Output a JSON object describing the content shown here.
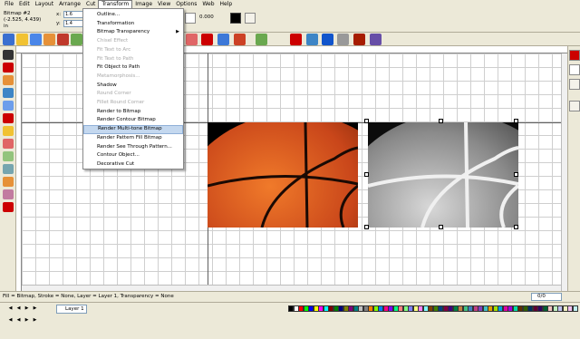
{
  "menubar": {
    "items": [
      "File",
      "Edit",
      "Layout",
      "Arrange",
      "Cut",
      "Transform",
      "Image",
      "View",
      "Options",
      "Web",
      "Help"
    ],
    "active": "Transform"
  },
  "propbar": {
    "object_name": "Bitmap #2",
    "coords": "(-2.525, 4.439)",
    "unit": "in",
    "x_label": "x:",
    "y_label": "y:",
    "x_value": "1.6",
    "y_value": "1.4",
    "angle_value": "0.000"
  },
  "transform_menu": {
    "items": [
      {
        "label": "Outline...",
        "disabled": false
      },
      {
        "label": "Transformation",
        "disabled": false
      },
      {
        "label": "Bitmap Transparency",
        "disabled": false,
        "submenu": true
      },
      {
        "label": "Chisel Effect",
        "disabled": true
      },
      {
        "label": "Fit Text to Arc",
        "disabled": true
      },
      {
        "label": "Fit Text to Path",
        "disabled": true
      },
      {
        "label": "Fit Object to Path",
        "disabled": false
      },
      {
        "label": "Metamorphosis...",
        "disabled": true
      },
      {
        "label": "Shadow",
        "disabled": false
      },
      {
        "label": "Round Corner",
        "disabled": true
      },
      {
        "label": "Fillet Round Corner",
        "disabled": true
      },
      {
        "label": "Render to Bitmap",
        "disabled": false
      },
      {
        "label": "Render Contour Bitmap",
        "disabled": false
      },
      {
        "label": "Render Multi-tone Bitmap",
        "disabled": false,
        "highlight": true
      },
      {
        "label": "Render Pattern Fill Bitmap",
        "disabled": false
      },
      {
        "label": "Render See Through Pattern...",
        "disabled": false
      },
      {
        "label": "Contour Object...",
        "disabled": false
      },
      {
        "label": "Decorative Cut",
        "disabled": false
      }
    ]
  },
  "status": {
    "text": "Fill = Bitmap, Stroke = None, Layer = Layer 1, Transparency = None",
    "page": "0/0"
  },
  "layers": {
    "active_layer": "Layer 1"
  },
  "palette": {
    "colors": [
      "#000000",
      "#ffffff",
      "#ff0000",
      "#00ff00",
      "#0000ff",
      "#ffff00",
      "#ff00ff",
      "#00ffff",
      "#800000",
      "#008000",
      "#000080",
      "#808000",
      "#800080",
      "#008080",
      "#c0c0c0",
      "#808080",
      "#ff8000",
      "#80ff00",
      "#0080ff",
      "#ff0080",
      "#8000ff",
      "#00ff80",
      "#ff8080",
      "#80ff80",
      "#8080ff",
      "#ffff80",
      "#ff80ff",
      "#80ffff",
      "#804000",
      "#408000",
      "#004080",
      "#800040",
      "#400080",
      "#008040",
      "#c08040",
      "#40c080",
      "#4080c0",
      "#c04080",
      "#8040c0",
      "#40c0c0",
      "#e0a000",
      "#a0e000",
      "#00a0e0",
      "#e000a0",
      "#a000e0",
      "#00e0a0",
      "#603000",
      "#306000",
      "#003060",
      "#600030",
      "#300060",
      "#006030",
      "#f0c0c0",
      "#c0f0c0",
      "#c0c0f0",
      "#f0f0c0",
      "#f0c0f0",
      "#c0f0f0"
    ]
  }
}
